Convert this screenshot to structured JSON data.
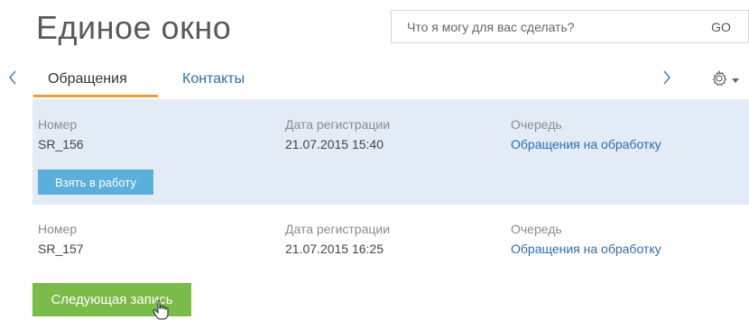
{
  "header": {
    "title": "Единое окно",
    "search_placeholder": "Что я могу для вас сделать?",
    "go_label": "GO"
  },
  "tabs": [
    {
      "label": "Обращения",
      "active": true
    },
    {
      "label": "Контакты",
      "active": false
    }
  ],
  "icons": {
    "left_arrow": "chevron-left-icon",
    "right_arrow": "chevron-right-icon",
    "settings": "gear-icon",
    "dropdown": "caret-down-icon",
    "cursor": "hand-cursor-icon"
  },
  "records": [
    {
      "number_label": "Номер",
      "number": "SR_156",
      "date_label": "Дата регистрации",
      "date": "21.07.2015 15:40",
      "queue_label": "Очередь",
      "queue": "Обращения на обработку",
      "action_label": "Взять в работу",
      "selected": true
    },
    {
      "number_label": "Номер",
      "number": "SR_157",
      "date_label": "Дата регистрации",
      "date": "21.07.2015 16:25",
      "queue_label": "Очередь",
      "queue": "Обращения на обработку",
      "action_label": "Следующая запись",
      "selected": false
    }
  ],
  "colors": {
    "accent_orange": "#f19c38",
    "link_blue": "#2c6db3",
    "selected_row": "#e2ebf6",
    "take_button": "#5bb0db",
    "next_button": "#7bbb47"
  }
}
